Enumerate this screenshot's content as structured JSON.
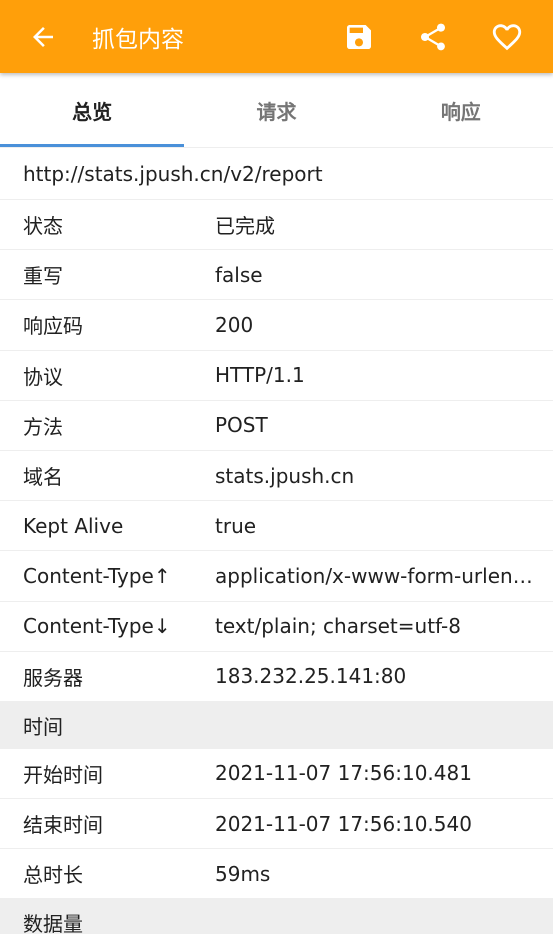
{
  "appbar": {
    "title": "抓包内容",
    "color": "#FF9F0A",
    "icons": [
      "arrow-back-icon",
      "save-icon",
      "share-icon",
      "heart-icon"
    ]
  },
  "tabs": [
    {
      "label": "总览",
      "active": true
    },
    {
      "label": "请求",
      "active": false
    },
    {
      "label": "响应",
      "active": false
    }
  ],
  "url": "http://stats.jpush.cn/v2/report",
  "overview": [
    {
      "key": "状态",
      "value": "已完成"
    },
    {
      "key": "重写",
      "value": "false"
    },
    {
      "key": "响应码",
      "value": "200"
    },
    {
      "key": "协议",
      "value": "HTTP/1.1"
    },
    {
      "key": "方法",
      "value": "POST"
    },
    {
      "key": "域名",
      "value": "stats.jpush.cn"
    },
    {
      "key": "Kept Alive",
      "value": "true"
    },
    {
      "key": "Content-Type↑",
      "value": "application/x-www-form-urlencoded"
    },
    {
      "key": "Content-Type↓",
      "value": "text/plain; charset=utf-8"
    },
    {
      "key": "服务器",
      "value": "183.232.25.141:80"
    }
  ],
  "time_section": {
    "title": "时间",
    "rows": [
      {
        "key": "开始时间",
        "value": "2021-11-07 17:56:10.481"
      },
      {
        "key": "结束时间",
        "value": "2021-11-07 17:56:10.540"
      },
      {
        "key": "总时长",
        "value": "59ms"
      }
    ]
  },
  "data_section": {
    "title": "数据量"
  },
  "accent_tab_indicator": "#4A90D9"
}
